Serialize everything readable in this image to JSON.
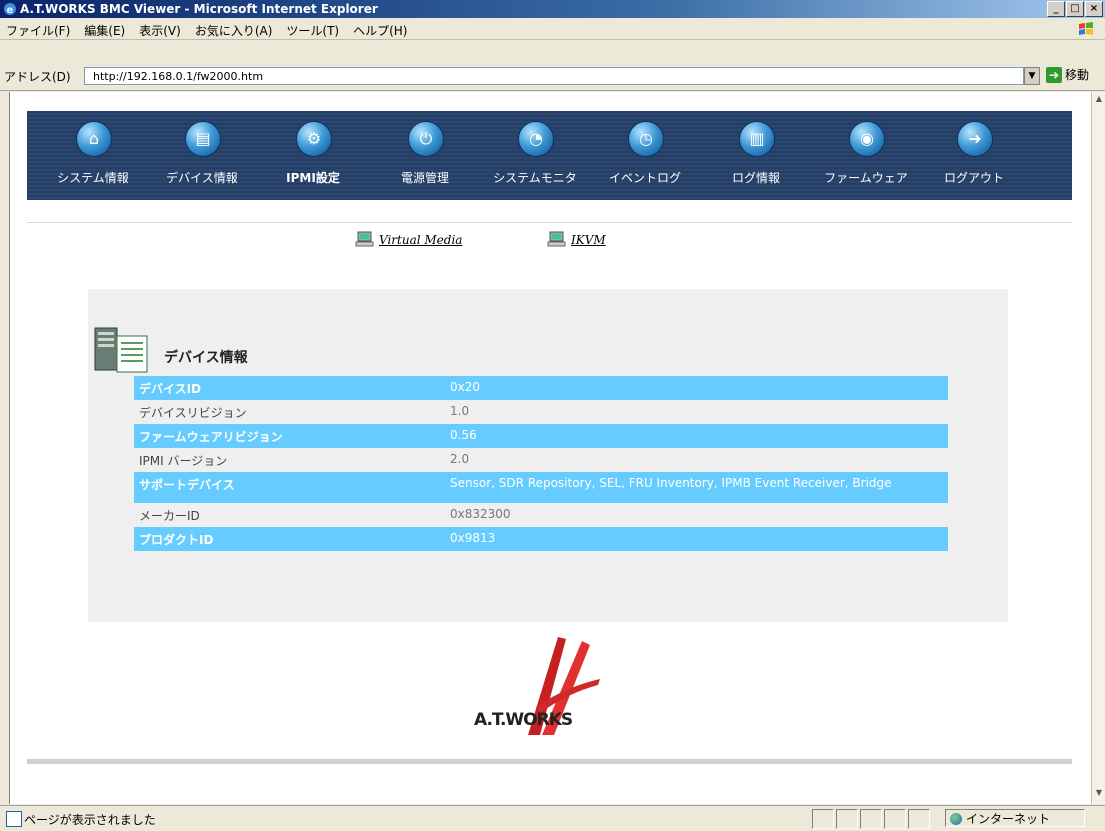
{
  "window": {
    "title": "A.T.WORKS BMC Viewer - Microsoft Internet Explorer",
    "buttons": [
      "_",
      "□",
      "×"
    ]
  },
  "menu": {
    "items": [
      "ファイル(F)",
      "編集(E)",
      "表示(V)",
      "お気に入り(A)",
      "ツール(T)",
      "ヘルプ(H)"
    ]
  },
  "address": {
    "label": "アドレス(D)",
    "url": "http://192.168.0.1/fw2000.htm",
    "go_label": "移動"
  },
  "nav": {
    "items": [
      {
        "label": "システム情報",
        "icon": "home-icon",
        "glyph": "⌂"
      },
      {
        "label": "デバイス情報",
        "icon": "device-icon",
        "glyph": "▤"
      },
      {
        "label": "IPMI設定",
        "icon": "ipmi-icon",
        "glyph": "⚙"
      },
      {
        "label": "電源管理",
        "icon": "power-icon",
        "glyph": "⏻"
      },
      {
        "label": "システムモニタ",
        "icon": "monitor-icon",
        "glyph": "◔"
      },
      {
        "label": "イベントログ",
        "icon": "event-log-icon",
        "glyph": "◷"
      },
      {
        "label": "ログ情報",
        "icon": "log-info-icon",
        "glyph": "▥"
      },
      {
        "label": "ファームウェア",
        "icon": "firmware-icon",
        "glyph": "◉"
      },
      {
        "label": "ログアウト",
        "icon": "logout-icon",
        "glyph": "➜"
      }
    ],
    "active_index": 2
  },
  "sublinks": {
    "virtual_media": "Virtual Media",
    "ikvm": "IKVM"
  },
  "device_info": {
    "heading": "デバイス情報",
    "rows": [
      {
        "key": "デバイスID",
        "value": "0x20"
      },
      {
        "key": "デバイスリビジョン",
        "value": "1.0"
      },
      {
        "key": "ファームウェアリビジョン",
        "value": "0.56"
      },
      {
        "key": "IPMI バージョン",
        "value": "2.0"
      },
      {
        "key": "サポートデバイス",
        "value": "Sensor, SDR Repository, SEL, FRU Inventory, IPMB Event Receiver, Bridge"
      },
      {
        "key": "メーカーID",
        "value": "0x832300"
      },
      {
        "key": "プロダクトID",
        "value": "0x9813"
      }
    ]
  },
  "footer": {
    "logo_text": "A.T.WORKS"
  },
  "status": {
    "text": "ページが表示されました",
    "zone": "インターネット"
  },
  "colors": {
    "nav_bg": "#243e64",
    "row_highlight": "#66ccff",
    "panel_bg": "#efefef"
  }
}
